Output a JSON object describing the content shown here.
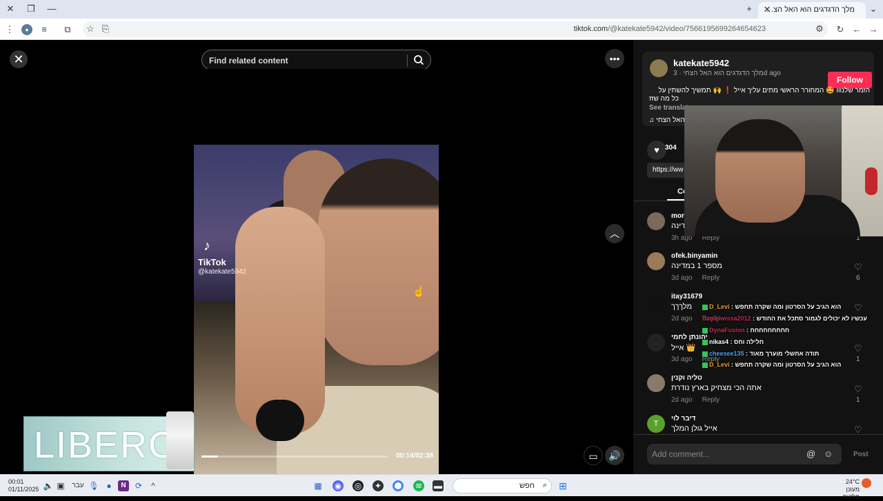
{
  "browser": {
    "tab_title": "מלך הדגדגים הוא האל הצ…",
    "url_host": "tiktok.com",
    "url_path": "/@katekate5942/video/7566195699264654623"
  },
  "player": {
    "search_placeholder": "Find related content",
    "watermark_brand": "TikTok",
    "watermark_user": "@katekate5942",
    "time_label": "00:14/02:38",
    "progress_fraction": 0.09,
    "overlay_brand": "LIBERO"
  },
  "post": {
    "username": "katekate5942",
    "subtitle_rtl": "מלך הדגדגים הוא האל הצחי",
    "time_ago": "3d ago",
    "follow_label": "Follow",
    "caption_line1": "הזמר שלנווו 🤩 המחורר הראשי מתים עליך אייל ❗ 🙌 תמשיך להשתין על",
    "caption_line2": "כל מה שזז",
    "see_translation": "See translat",
    "sound_text": "האל הצחי",
    "likes": "304",
    "link_text": "https://ww",
    "comments_tab": "Co"
  },
  "comments": [
    {
      "user": "mor",
      "text": "דינה",
      "time": "3h ago",
      "reply": "Reply",
      "likes": "1"
    },
    {
      "user": "ofek.binyamin",
      "text": "מספר 1 במדינה",
      "time": "3d ago",
      "reply": "Reply",
      "likes": "6"
    },
    {
      "user": "itay31679",
      "text": "מלךךך",
      "time": "2d ago",
      "reply": "Reply",
      "likes": ""
    },
    {
      "user": "יהונתן לחמי",
      "text": "אייל 👑",
      "time": "3d ago",
      "reply": "Reply",
      "likes": "1"
    },
    {
      "user": "טליה וקנין",
      "text": "אתה הכי מצחיק בארץ נודרת",
      "time": "2d ago",
      "reply": "Reply",
      "likes": "1"
    },
    {
      "user": "דיבר לוי",
      "text": "אייל גולן המלך",
      "time": "",
      "reply": "",
      "likes": ""
    }
  ],
  "add_comment": {
    "placeholder": "Add comment...",
    "post_label": "Post"
  },
  "stream_chat": [
    {
      "nick": "D_Levi",
      "msg": "הוא הגיב על הסרטון ומה שקרה תחפש",
      "color": "o"
    },
    {
      "nick": "danielwissa2012",
      "msg": "עכשיו לא יכולים לגמור סתכל את החודש",
      "color": "p"
    },
    {
      "nick": "DynaFusion",
      "msg": "חחחחחחחחח",
      "color": "p"
    },
    {
      "nick": "nikas4",
      "msg": "חלילה וחס",
      "color": "w"
    },
    {
      "nick": "cheesee135",
      "msg": "תודה אחשלי מוערך מאוד",
      "color": "b"
    },
    {
      "nick": "D_Levi",
      "msg": "הוא הגיב על הסרטון ומה שקרה תחפש",
      "color": "o"
    }
  ],
  "taskbar": {
    "time": "00:01",
    "date": "01/11/2025",
    "lang": "עבר",
    "search_text": "חפש",
    "temp": "24°C",
    "weather_desc": "מעונן חלקית"
  }
}
